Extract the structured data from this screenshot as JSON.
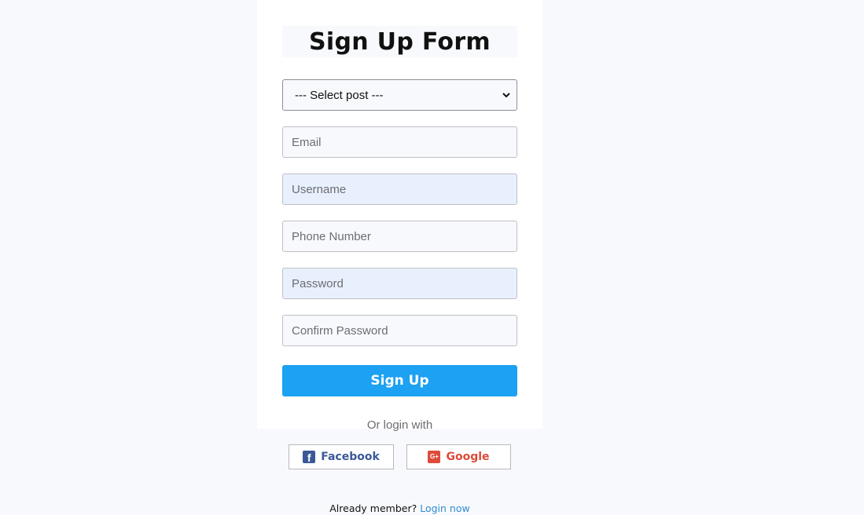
{
  "form": {
    "title": "Sign Up Form",
    "post_select": {
      "selected": "--- Select post ---"
    },
    "fields": {
      "email_placeholder": "Email",
      "username_placeholder": "Username",
      "phone_placeholder": "Phone Number",
      "password_placeholder": "Password",
      "confirm_password_placeholder": "Confirm Password"
    },
    "signup_label": "Sign Up"
  },
  "social": {
    "or_login_label": "Or login with",
    "facebook_label": "Facebook",
    "google_label": "Google",
    "facebook_color": "#3b5998",
    "google_color": "#dd4b39"
  },
  "footer": {
    "member_text": "Already member?",
    "login_link": "Login now"
  },
  "colors": {
    "primary_button": "#1da1f2",
    "link": "#2f8ccf",
    "page_background": "#f8f9fd",
    "autofill_background": "#e8f0fe"
  },
  "icons": {
    "select_chevron": "chevron-down-icon",
    "facebook": "facebook-icon",
    "google": "google-plus-icon"
  }
}
